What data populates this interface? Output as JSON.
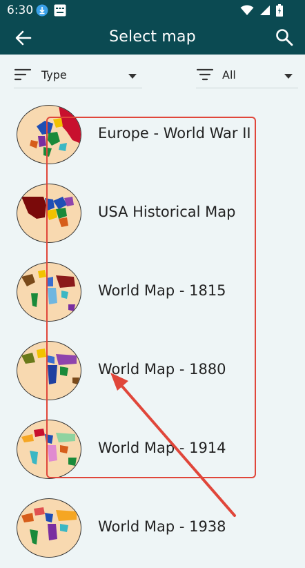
{
  "status": {
    "time": "6:30",
    "icons": [
      "download-icon",
      "keyboard-icon",
      "wifi-icon",
      "signal-icon",
      "battery-icon"
    ]
  },
  "appbar": {
    "title": "Select map",
    "back_icon": "arrow-back-icon",
    "search_icon": "search-icon"
  },
  "filters": [
    {
      "label": "Type",
      "icon": "sort-icon"
    },
    {
      "label": "All",
      "icon": "filter-icon"
    }
  ],
  "maps": [
    {
      "title": "Europe - World War II"
    },
    {
      "title": "USA Historical Map"
    },
    {
      "title": "World Map - 1815"
    },
    {
      "title": "World Map - 1880"
    },
    {
      "title": "World Map - 1914"
    },
    {
      "title": "World Map - 1938"
    }
  ],
  "colors": {
    "appbar": "#0b4a52",
    "background": "#eef5f6",
    "annotation": "#e0463a",
    "map_land": "#f8d9b0"
  }
}
